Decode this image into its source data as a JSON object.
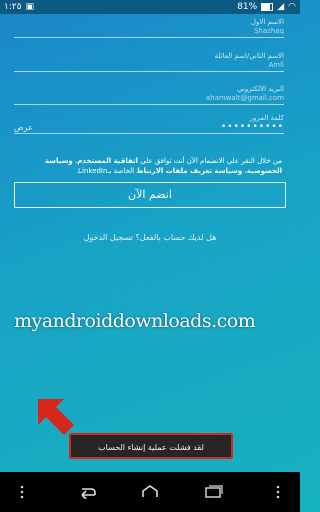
{
  "status_bar": {
    "time": "١:٢٥",
    "battery": "81%",
    "icons": [
      "image-icon",
      "signal-icon",
      "wifi-icon",
      "battery-icon",
      "antenna-icon"
    ]
  },
  "form": {
    "first_name": {
      "label": "الاسم الاول",
      "value": "Shazhaq"
    },
    "last_name": {
      "label": "الاسم الثاني/اسم العائلة",
      "value": "Amli"
    },
    "email": {
      "label": "البريد الالكتروني",
      "value": "ahamwalt@gmail.com"
    },
    "password": {
      "label": "كلمة المرور",
      "value": "••••••••••",
      "show_label": "عرض"
    }
  },
  "terms": {
    "part1": "من خلال النقر على الانضمام الآن أنت توافق على",
    "agreement": "اتفاقية المستخدم",
    "part2": "،",
    "privacy": "وسياسة الخصوصية",
    "part3": "،",
    "cookies": "وسياسة تعريف ملفات الارتباط",
    "part4": "الخاصة بـLinkedIn."
  },
  "join_button": "انضم الآن",
  "signin_link": "هل لديك حساب بالفعل؟ تسجيل الدخول",
  "watermark": "myandroiddownloads.com",
  "toast": "لقد فشلت عملية إنشاء الحساب",
  "colors": {
    "accent_red": "#d8261b",
    "background_start": "#1a86c9",
    "background_end": "#17b2bf"
  },
  "nav_icons": [
    "menu-dots-icon",
    "back-icon",
    "home-icon",
    "recent-apps-icon",
    "overflow-icon"
  ]
}
